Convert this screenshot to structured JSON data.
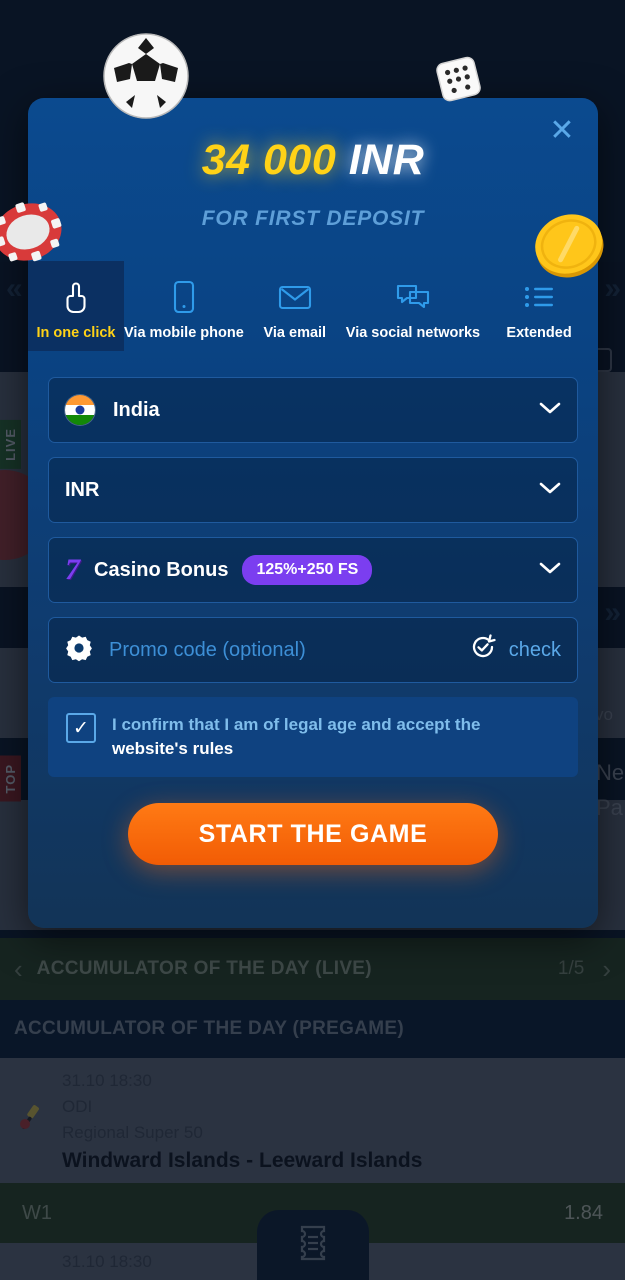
{
  "modal": {
    "close_label": "✕",
    "hero": {
      "amount": "34 000",
      "currency": "INR",
      "subtitle": "FOR FIRST DEPOSIT"
    },
    "decor": {
      "ball": "soccer-ball",
      "dice": "dice",
      "chip": "poker-chip",
      "coin": "gold-coin"
    },
    "tabs": [
      {
        "id": "one-click",
        "label": "In one click",
        "icon": "hand-pointer-icon",
        "active": true
      },
      {
        "id": "mobile-phone",
        "label": "Via mobile phone",
        "icon": "mobile-phone-icon",
        "active": false
      },
      {
        "id": "email",
        "label": "Via email",
        "icon": "envelope-icon",
        "active": false
      },
      {
        "id": "social",
        "label": "Via social networks",
        "icon": "chat-bubbles-icon",
        "active": false
      },
      {
        "id": "extended",
        "label": "Extended",
        "icon": "list-icon",
        "active": false
      }
    ],
    "form": {
      "country": {
        "value": "India",
        "icon": "india-flag-icon"
      },
      "currency": {
        "value": "INR"
      },
      "bonus": {
        "value": "Casino Bonus",
        "badge": "125%+250 FS",
        "icon": "lucky-seven-icon"
      },
      "promo": {
        "placeholder": "Promo code (optional)",
        "check_label": "check",
        "icon": "gear-icon",
        "check_icon": "refresh-check-icon"
      },
      "consent": {
        "text_part1": "I confirm that I am of legal age and accept the ",
        "text_part2": "website's rules",
        "checked": true
      },
      "submit_label": "START THE GAME"
    },
    "colors": {
      "accent_yellow": "#ffd217",
      "cta_orange": "#f25c05",
      "bonus_purple": "#7b3ef0",
      "link_blue": "#5aa8e8"
    }
  },
  "background": {
    "accumulator_live": {
      "title": "ACCUMULATOR OF THE DAY (LIVE)",
      "counter": "1/5",
      "prev": "‹",
      "next": "›"
    },
    "accumulator_pregame": {
      "title": "ACCUMULATOR OF THE DAY (PREGAME)"
    },
    "event": {
      "time": "31.10 18:30",
      "type": "ODI",
      "league": "Regional Super 50",
      "teams": "Windward Islands - Leeward Islands",
      "icon": "cricket-icon"
    },
    "odds": {
      "label": "W1",
      "value": "1.84"
    },
    "event2": {
      "time": "31.10 18:30"
    },
    "badges": {
      "live": "LIVE",
      "top": "TOP"
    },
    "betslip_icon": "betslip-ticket-icon",
    "chevrons": {
      "left": "«",
      "right": "»"
    }
  }
}
